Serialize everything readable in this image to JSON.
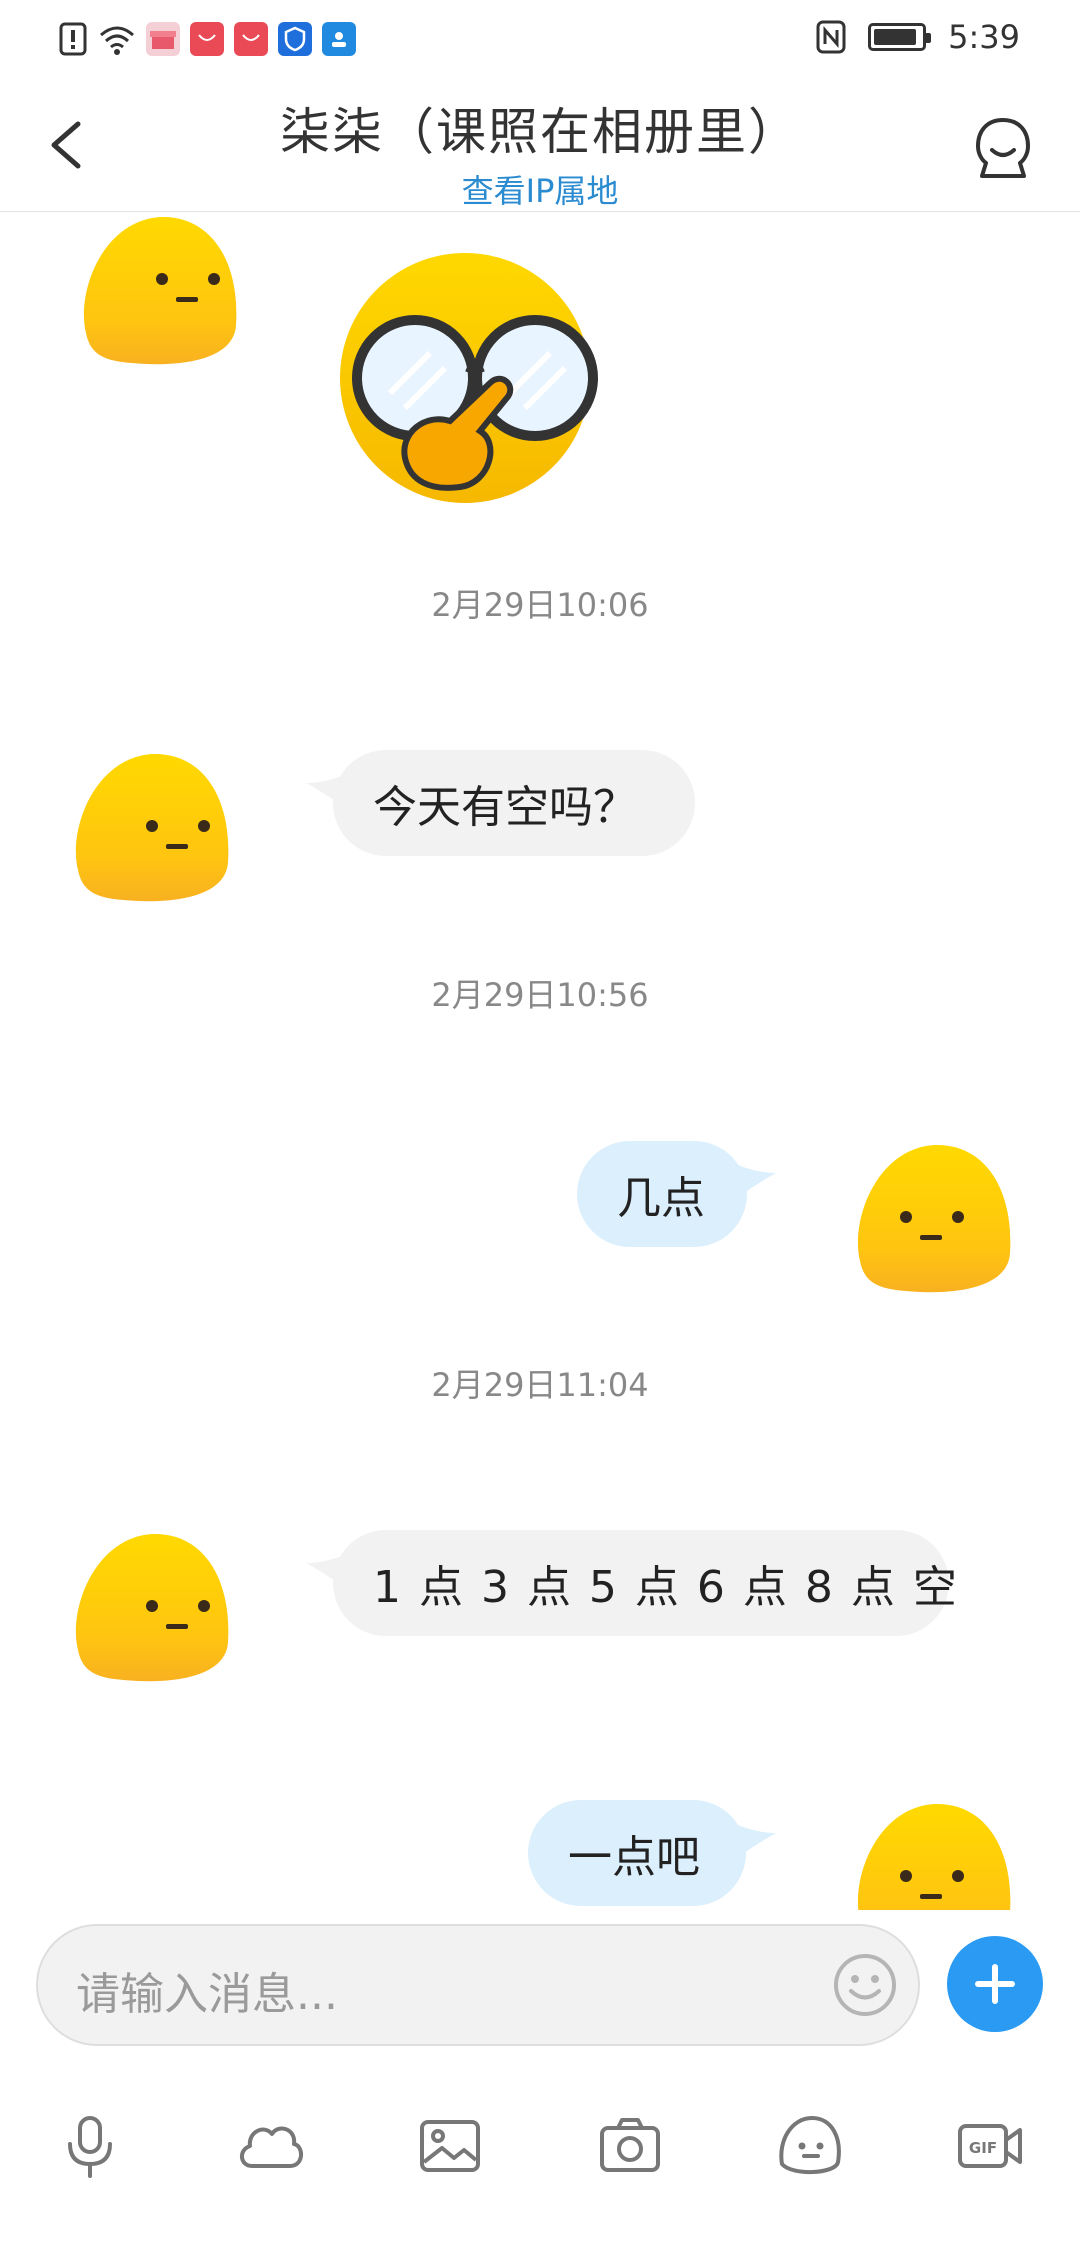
{
  "status_bar": {
    "time": "5:39",
    "app_icons": [
      "warning-icon",
      "wifi-icon",
      "gift-box-icon",
      "huawei-shop-icon",
      "huawei-shop-icon",
      "shield-icon",
      "contacts-icon"
    ]
  },
  "header": {
    "title": "柒柒（课照在相册里）",
    "subtitle": "查看IP属地"
  },
  "messages": [
    {
      "type": "sticker",
      "from": "them"
    },
    {
      "type": "timestamp",
      "text": "2月29日10:06"
    },
    {
      "type": "text",
      "from": "them",
      "text": "今天有空吗？"
    },
    {
      "type": "timestamp",
      "text": "2月29日10:56"
    },
    {
      "type": "text",
      "from": "me",
      "text": "几点"
    },
    {
      "type": "timestamp",
      "text": "2月29日11:04"
    },
    {
      "type": "text",
      "from": "them",
      "text": "1 点 3 点 5 点 6 点 8 点 空"
    },
    {
      "type": "text",
      "from": "me",
      "text": "一点吧"
    }
  ],
  "input": {
    "placeholder": "请输入消息..."
  },
  "toolbar": {
    "items": [
      "microphone-icon",
      "cloud-icon",
      "image-icon",
      "camera-icon",
      "sticker-face-icon",
      "gif-video-icon"
    ]
  },
  "colors": {
    "accent_blue": "#2a9af3",
    "link_blue": "#2a8bd1",
    "incoming_bubble": "#f2f2f2",
    "outgoing_bubble": "#dbeffd",
    "avatar_yellow": "#fdd017"
  }
}
